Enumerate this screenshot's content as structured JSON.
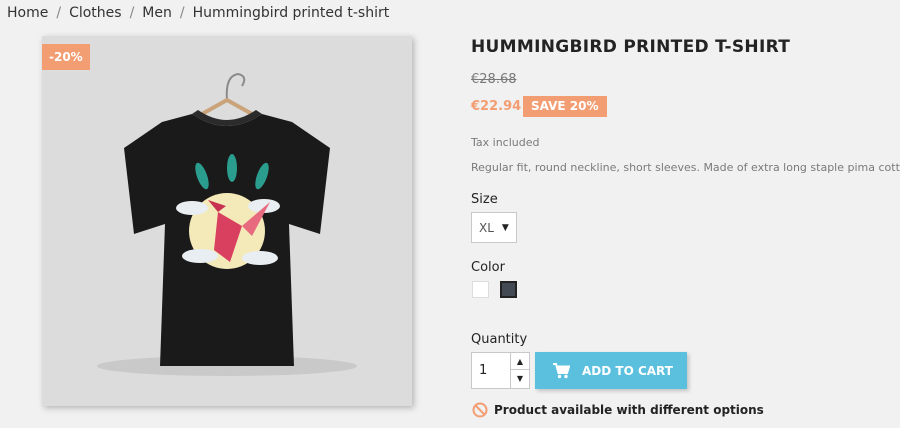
{
  "breadcrumb": [
    "Home",
    "Clothes",
    "Men",
    "Hummingbird printed t-shirt"
  ],
  "breadcrumb_separator": "/",
  "discount_flag": "-20%",
  "product": {
    "title": "HUMMINGBIRD PRINTED T-SHIRT",
    "regular_price": "€28.68",
    "current_price": "€22.94",
    "save_badge": "SAVE 20%",
    "tax_label": "Tax included",
    "description": "Regular fit, round neckline, short sleeves. Made of extra long staple pima cotton."
  },
  "size": {
    "label": "Size",
    "selected": "XL"
  },
  "color": {
    "label": "Color",
    "options": [
      "white",
      "black"
    ],
    "selected": "black",
    "swatches": [
      "#ffffff",
      "#434a54"
    ]
  },
  "quantity": {
    "label": "Quantity",
    "value": "1"
  },
  "add_to_cart_label": "ADD TO CART",
  "availability": "Product available with different options",
  "colors": {
    "accent_orange": "#f39d72",
    "cart_button": "#5bc0de",
    "text": "#232323"
  },
  "icons": [
    "shopping-cart-icon",
    "ban-icon",
    "chevron-up-icon",
    "chevron-down-icon",
    "caret-down-icon"
  ]
}
